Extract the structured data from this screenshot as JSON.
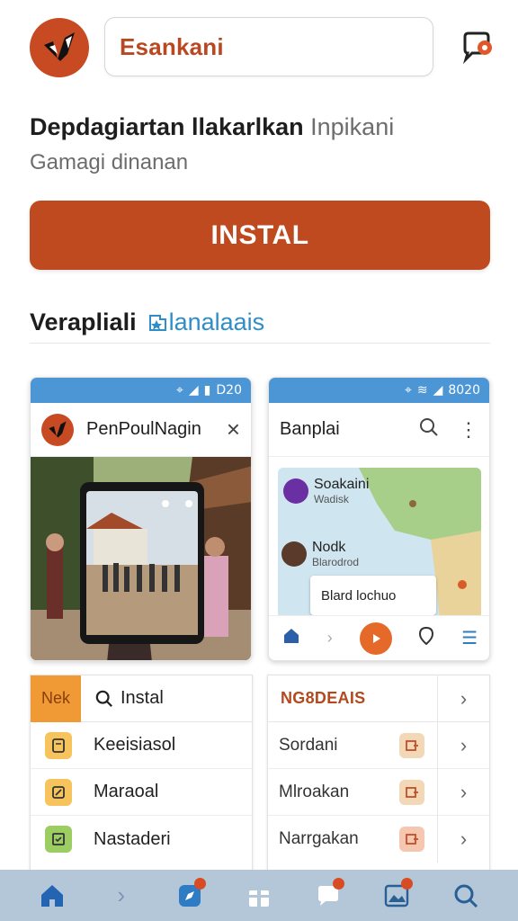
{
  "header": {
    "search_value": "Esankani"
  },
  "hero": {
    "title_bold": "Depdagiartan llakarlkan",
    "title_light": "Inpikani",
    "subtitle": "Gamagi dinanan",
    "install_label": "INSTAL"
  },
  "section": {
    "title": "Verapliali",
    "link": "lanalaais"
  },
  "card_left": {
    "status_time": "D20",
    "title": "PenPoulNagin",
    "close_glyph": "×"
  },
  "card_right": {
    "status_time": "8020",
    "title": "Banplai",
    "item1_name": "Soakaini",
    "item1_sub": "Wadisk",
    "item2_name": "Nodk",
    "item2_sub": "Blarodrod",
    "bubble_text": "Blard lochuo"
  },
  "list_left": {
    "tag": "Nek",
    "header": "Instal",
    "items": [
      {
        "label": "Keeisiasol",
        "icon": "receipt-icon",
        "color": "#f7c35c"
      },
      {
        "label": "Maraoal",
        "icon": "edit-icon",
        "color": "#f7c35c"
      },
      {
        "label": "Nastaderi",
        "icon": "calendar-icon",
        "color": "#9ccd62"
      }
    ]
  },
  "list_right": {
    "header": "NG8DEAIS",
    "items": [
      {
        "label": "Sordani"
      },
      {
        "label": "Mlroakan"
      },
      {
        "label": "Narrgakan"
      }
    ]
  },
  "colors": {
    "brand": "#bf4a1f",
    "status_bar": "#4c96d6",
    "bottom_nav": "#b3c7d9"
  }
}
